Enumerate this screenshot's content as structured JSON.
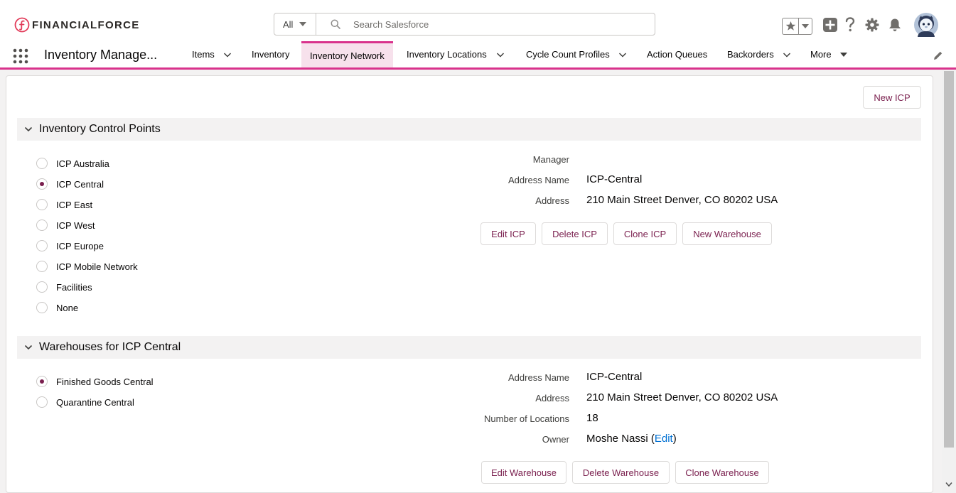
{
  "brand": {
    "name": "FINANCIALFORCE",
    "accent": "#d9328c",
    "button_text_color": "#7a1f4e"
  },
  "search": {
    "scope": "All",
    "placeholder": "Search Salesforce"
  },
  "header_icons": [
    "favorites-star-icon",
    "chevron-down-icon",
    "global-actions-icon",
    "help-icon",
    "setup-gear-icon",
    "notifications-bell-icon",
    "avatar"
  ],
  "nav": {
    "app_name": "Inventory Manage...",
    "items": [
      {
        "label": "Items",
        "has_menu": true
      },
      {
        "label": "Inventory",
        "has_menu": false
      },
      {
        "label": "Inventory Network",
        "has_menu": false,
        "active": true
      },
      {
        "label": "Inventory Locations",
        "has_menu": true
      },
      {
        "label": "Cycle Count Profiles",
        "has_menu": true
      },
      {
        "label": "Action Queues",
        "has_menu": false
      },
      {
        "label": "Backorders",
        "has_menu": true
      },
      {
        "label": "More",
        "has_menu": true
      }
    ]
  },
  "page": {
    "new_icp_button": "New ICP",
    "icp_section": {
      "title": "Inventory Control Points",
      "options": [
        "ICP Australia",
        "ICP Central",
        "ICP East",
        "ICP West",
        "ICP Europe",
        "ICP Mobile Network",
        "Facilities",
        "None"
      ],
      "selected": "ICP Central",
      "details": {
        "manager_label": "Manager",
        "manager_value": "",
        "address_name_label": "Address Name",
        "address_name_value": "ICP-Central",
        "address_label": "Address",
        "address_value": "210 Main Street Denver, CO 80202 USA"
      },
      "buttons": [
        "Edit ICP",
        "Delete ICP",
        "Clone ICP",
        "New Warehouse"
      ]
    },
    "warehouse_section": {
      "title": "Warehouses for ICP Central",
      "options": [
        "Finished Goods Central",
        "Quarantine Central"
      ],
      "selected": "Finished Goods Central",
      "details": {
        "address_name_label": "Address Name",
        "address_name_value": "ICP-Central",
        "address_label": "Address",
        "address_value": "210 Main Street Denver, CO 80202 USA",
        "locations_label": "Number of Locations",
        "locations_value": "18",
        "owner_label": "Owner",
        "owner_value": "Moshe Nassi",
        "owner_paren_open": "(",
        "owner_edit_link": "Edit",
        "owner_paren_close": ")"
      },
      "buttons": [
        "Edit Warehouse",
        "Delete Warehouse",
        "Clone Warehouse"
      ]
    }
  }
}
